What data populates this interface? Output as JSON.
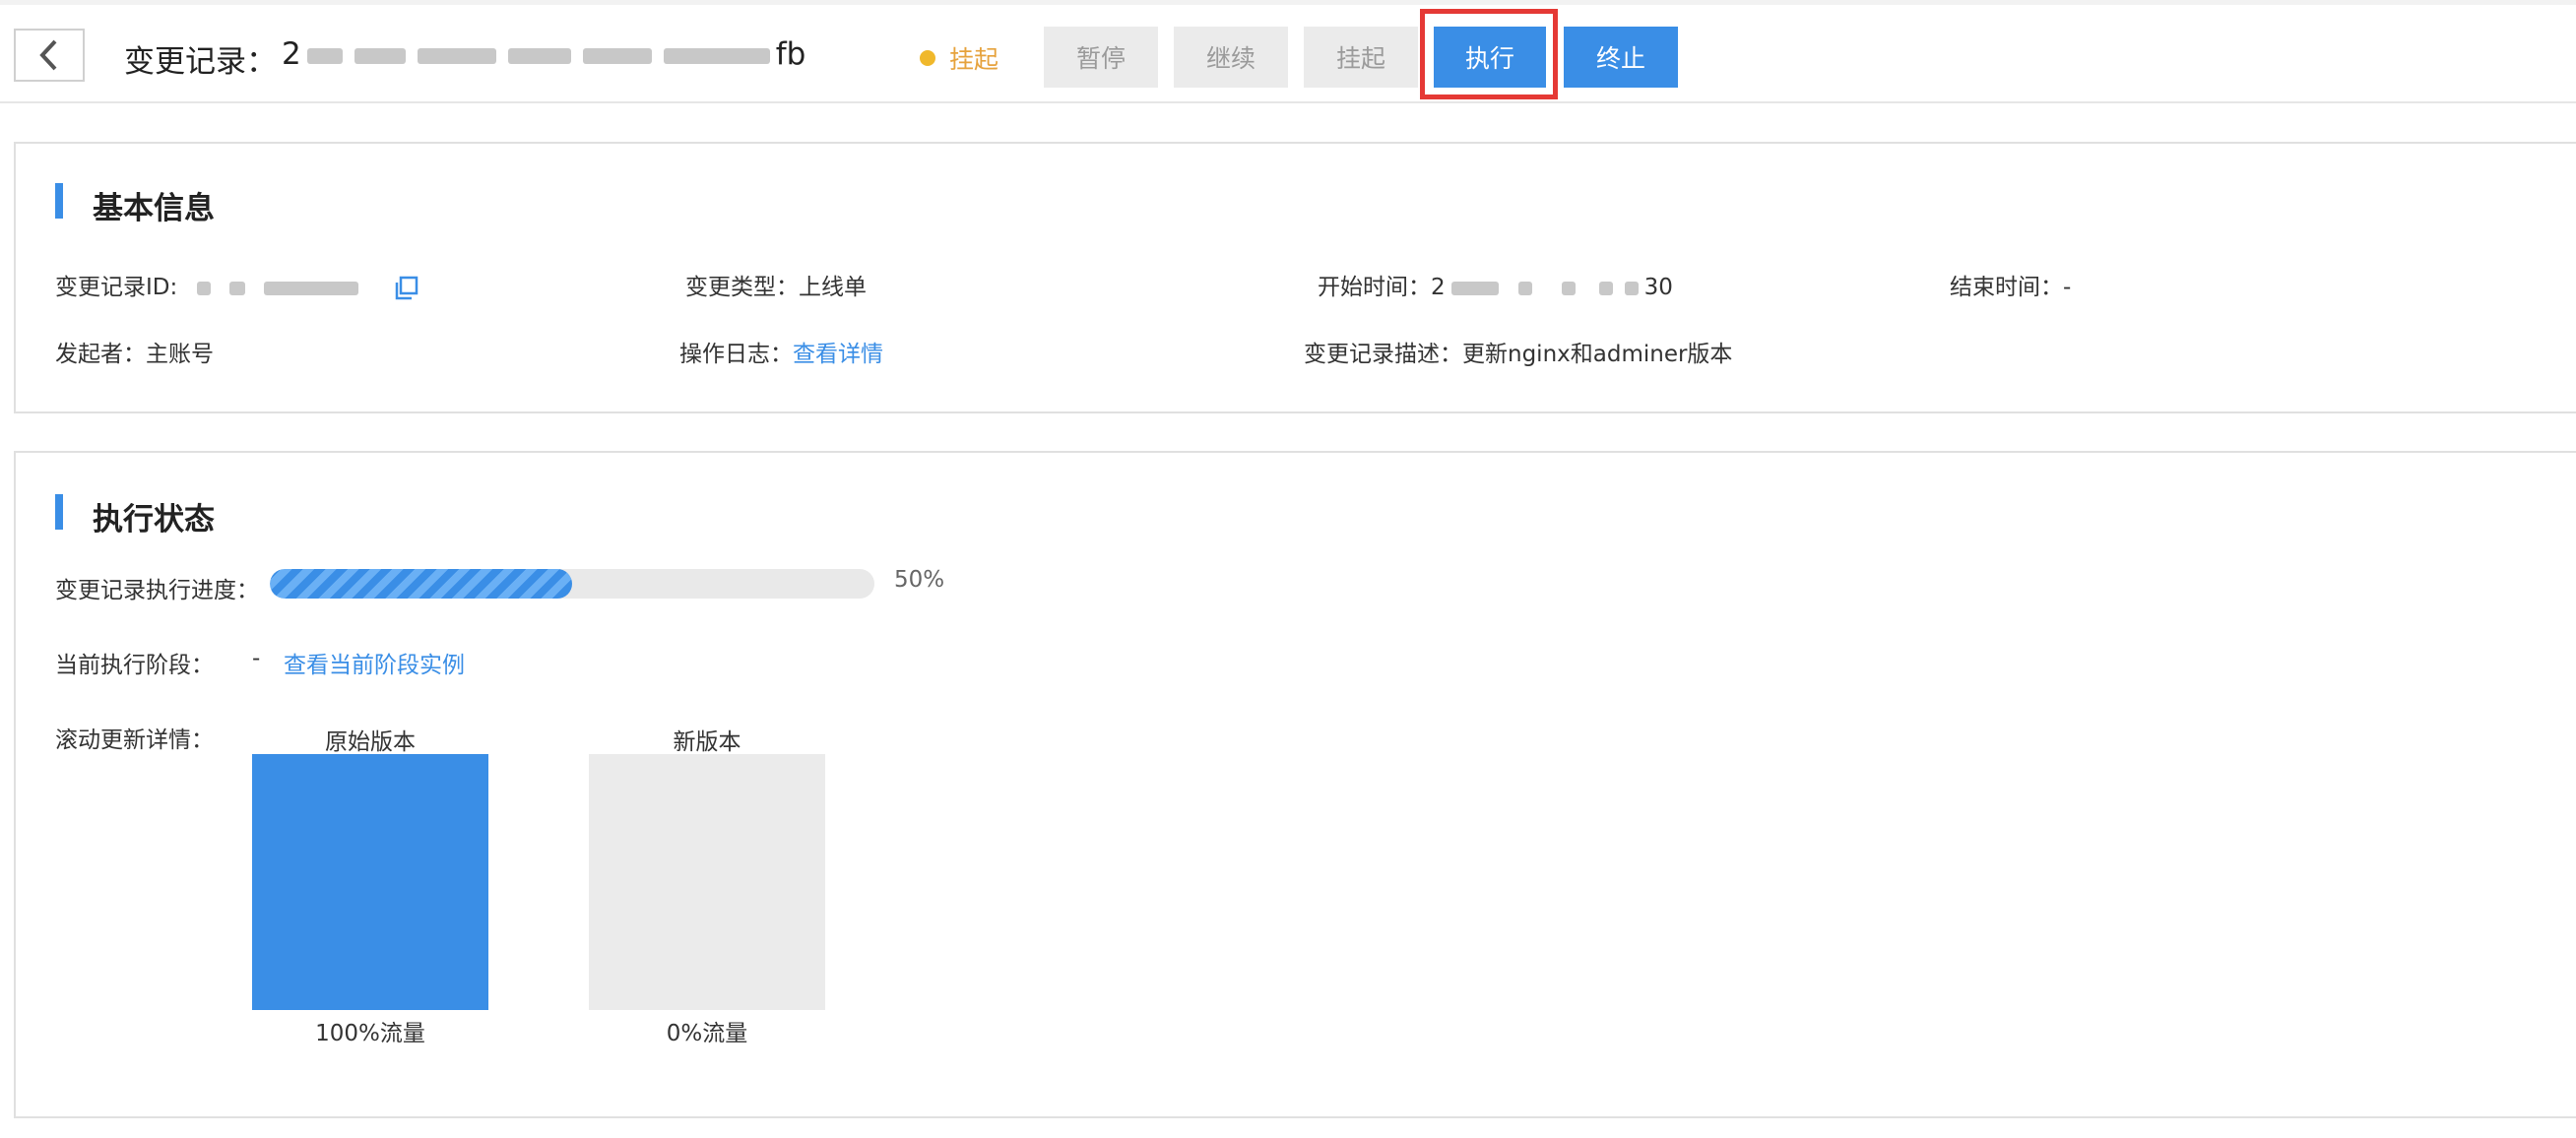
{
  "header": {
    "back_icon": "chevron-left-icon",
    "title_label": "变更记录：",
    "title_id_prefix": "2",
    "title_id_suffix": "fb",
    "status": {
      "label": "挂起",
      "color": "#f0b82b"
    },
    "buttons": [
      {
        "label": "暂停",
        "state": "disabled"
      },
      {
        "label": "继续",
        "state": "disabled"
      },
      {
        "label": "挂起",
        "state": "disabled"
      },
      {
        "label": "执行",
        "state": "primary",
        "highlighted": true
      },
      {
        "label": "终止",
        "state": "primary"
      }
    ]
  },
  "basic_info": {
    "title": "基本信息",
    "record_id_label": "变更记录ID:",
    "copy_icon": "copy-icon",
    "change_type_label": "变更类型：",
    "change_type": "上线单",
    "start_time_label": "开始时间：",
    "start_time_prefix": "2",
    "start_time_suffix": "30",
    "end_time_label": "结束时间：",
    "end_time": "-",
    "initiator_label": "发起者：",
    "initiator": "主账号",
    "op_log_label": "操作日志：",
    "op_log_link": "查看详情",
    "desc_label": "变更记录描述：",
    "desc": "更新nginx和adminer版本"
  },
  "exec_status": {
    "title": "执行状态",
    "progress_label": "变更记录执行进度：",
    "progress_percent": 50,
    "progress_text": "50%",
    "stage_label": "当前执行阶段：",
    "stage_value": "-",
    "stage_link": "查看当前阶段实例",
    "rolling_label": "滚动更新详情：",
    "versions": [
      {
        "name": "原始版本",
        "traffic": "100%流量",
        "color": "#3a8ee6"
      },
      {
        "name": "新版本",
        "traffic": "0%流量",
        "color": "#ebebeb"
      }
    ]
  },
  "colors": {
    "accent": "#3a8ee6",
    "highlight_border": "#e53935",
    "warning": "#f0b82b"
  }
}
